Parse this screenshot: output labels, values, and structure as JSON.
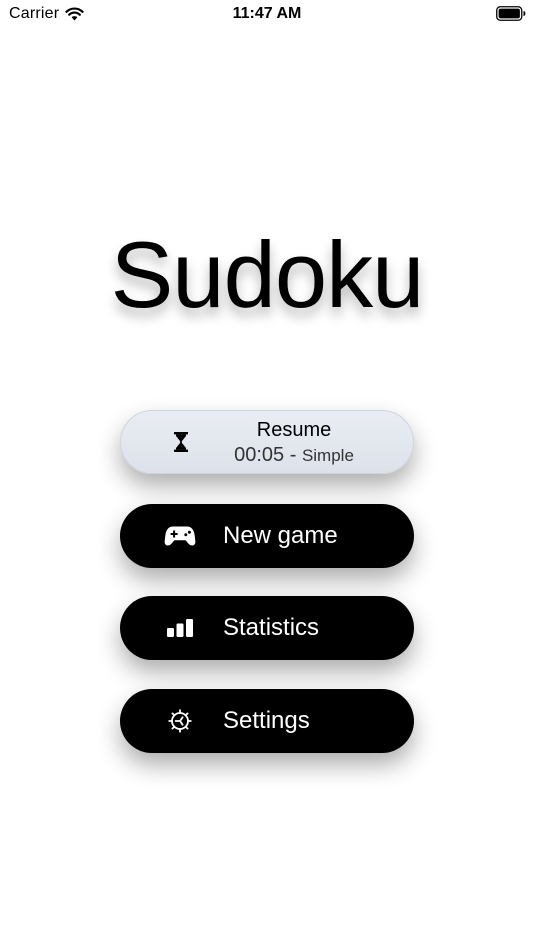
{
  "status_bar": {
    "carrier": "Carrier",
    "time": "11:47 AM"
  },
  "title": "Sudoku",
  "menu": {
    "resume": {
      "label": "Resume",
      "time": "00:05",
      "separator": "-",
      "level": "Simple",
      "icon": "hourglass-icon"
    },
    "new_game": {
      "label": "New game",
      "icon": "gamepad-icon"
    },
    "statistics": {
      "label": "Statistics",
      "icon": "bar-chart-icon"
    },
    "settings": {
      "label": "Settings",
      "icon": "gear-icon"
    }
  },
  "colors": {
    "background": "#ffffff",
    "button_dark": "#000000",
    "button_light": "#e3e7ee"
  }
}
